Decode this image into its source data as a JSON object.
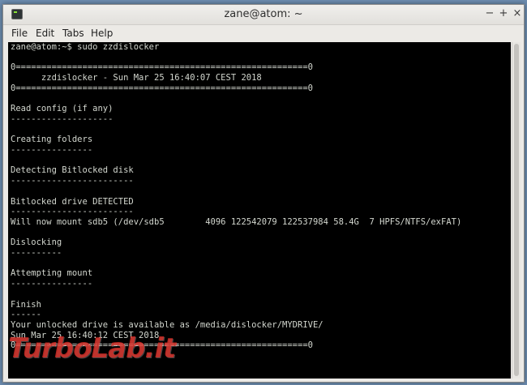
{
  "window": {
    "title": "zane@atom: ~",
    "minimize_glyph": "−",
    "maximize_glyph": "+",
    "close_glyph": "×"
  },
  "menu": {
    "file": "File",
    "edit": "Edit",
    "tabs": "Tabs",
    "help": "Help"
  },
  "terminal": {
    "prompt_line": "zane@atom:~$ sudo zzdislocker",
    "output": "zane@atom:~$ sudo zzdislocker\n\n0=========================================================0\n      zzdislocker - Sun Mar 25 16:40:07 CEST 2018\n0=========================================================0\n\nRead config (if any)\n--------------------\n\nCreating folders\n----------------\n\nDetecting Bitlocked disk\n------------------------\n\nBitlocked drive DETECTED\n------------------------\nWill now mount sdb5 (/dev/sdb5        4096 122542079 122537984 58.4G  7 HPFS/NTFS/exFAT)\n\nDislocking\n----------\n\nAttempting mount\n----------------\n\nFinish\n------\nYour unlocked drive is available as /media/dislocker/MYDRIVE/\nSun Mar 25 16:40:12 CEST 2018\n0=========================================================0"
  },
  "watermark": {
    "text": "TurboLab.it"
  },
  "colors": {
    "terminal_bg": "#000000",
    "terminal_fg": "#d3d7cf",
    "watermark": "#e13028"
  },
  "icons": {
    "app": "terminal-icon"
  }
}
